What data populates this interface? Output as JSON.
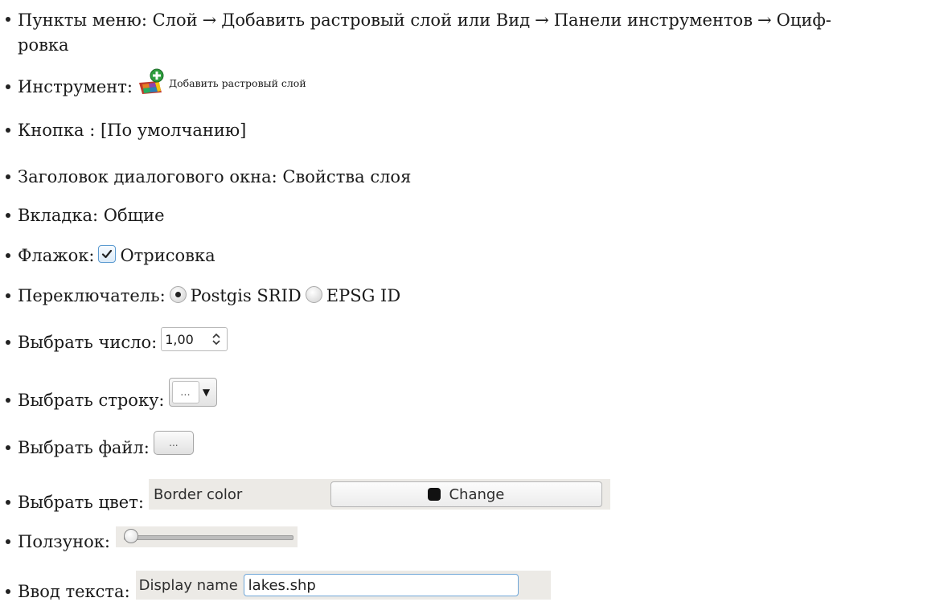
{
  "items": {
    "menu": {
      "label": "Пункты меню: ",
      "path1": [
        "Слой",
        "Добавить растровый слой"
      ],
      "or": " или ",
      "path2": [
        "Вид",
        "Панели инструментов",
        "Оциф-"
      ],
      "continuation": "ровка",
      "arrow": "→"
    },
    "tool": {
      "label": "Инструмент:",
      "icon": "add-raster-layer-icon",
      "caption": "Добавить растровый слой"
    },
    "button": {
      "text": "Кнопка : [По умолчанию]"
    },
    "dialog_title": {
      "text": "Заголовок диалогового окна: Свойства слоя"
    },
    "tab": {
      "text": "Вкладка: Общие"
    },
    "checkbox": {
      "label": "Флажок:",
      "checked": true,
      "text": "Отрисовка"
    },
    "radio": {
      "label": "Переключатель:",
      "option1": "Postgis SRID",
      "option1_checked": true,
      "option2": "EPSG ID",
      "option2_checked": false
    },
    "spin": {
      "label": "Выбрать число:",
      "value": "1,00",
      "icon": "up-down-arrows-icon"
    },
    "combo": {
      "label": "Выбрать строку:",
      "value": "...",
      "arrow": "▼"
    },
    "file": {
      "label": "Выбрать файл:",
      "button_text": "..."
    },
    "color": {
      "label": "Выбрать цвет:",
      "field_label": "Border color",
      "button_text": "Change",
      "swatch_color": "#111111"
    },
    "slider": {
      "label": "Ползунок:",
      "value_fraction": 0
    },
    "text_input": {
      "label": "Ввод текста:",
      "field_label": "Display name",
      "value": "lakes.shp"
    }
  }
}
